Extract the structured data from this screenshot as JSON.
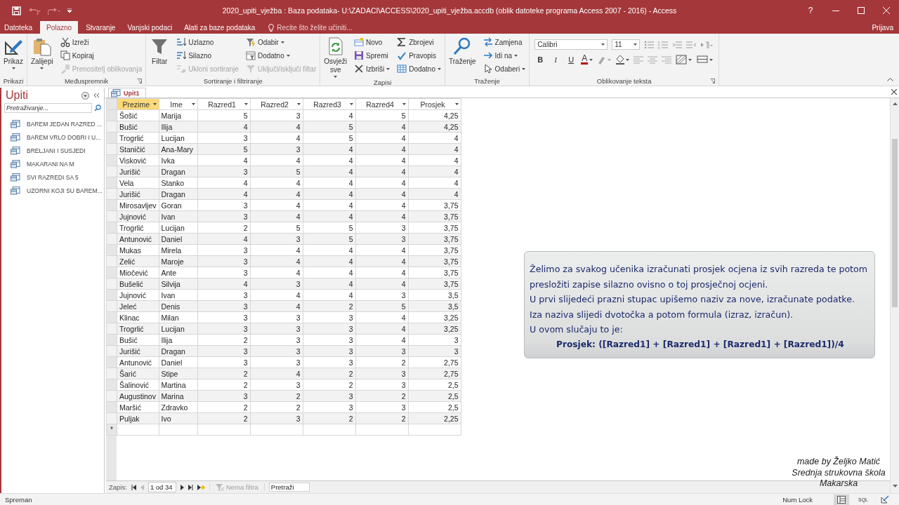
{
  "window": {
    "title": "2020_upiti_vježba : Baza podataka- U:\\ZADACI\\ACCESS\\2020_upiti_vježba.accdb (oblik datoteke programa Access 2007 - 2016) - Access",
    "help": "?"
  },
  "ribbon_tabs": [
    {
      "label": "Datoteka",
      "selected": false
    },
    {
      "label": "Polazno",
      "selected": true
    },
    {
      "label": "Stvaranje",
      "selected": false
    },
    {
      "label": "Vanjski podaci",
      "selected": false
    },
    {
      "label": "Alati za baze podataka",
      "selected": false
    }
  ],
  "tell_me": {
    "placeholder": "Recite što želite učiniti..."
  },
  "account": "Prijava",
  "ribbon": {
    "groups": [
      {
        "label": "Prikazi",
        "kind": "buttons",
        "launcher": false,
        "columns": [
          [
            {
              "label": "Prikaz",
              "kind": "large",
              "dropdown": true,
              "disabled": false
            }
          ]
        ]
      },
      {
        "label": "Međuspremnik",
        "kind": "buttons",
        "launcher": true,
        "columns": [
          [
            {
              "label": "Zalijepi",
              "kind": "large",
              "dropdown": true,
              "disabled": false
            }
          ],
          [
            {
              "label": "Izreži",
              "kind": "small",
              "dropdown": false,
              "disabled": false
            },
            {
              "label": "Kopiraj",
              "kind": "small",
              "dropdown": false,
              "disabled": false
            },
            {
              "label": "Prenositelj oblikovanja",
              "kind": "small",
              "dropdown": false,
              "disabled": true
            }
          ]
        ]
      },
      {
        "label": "Sortiranje i filtriranje",
        "kind": "buttons",
        "launcher": false,
        "columns": [
          [
            {
              "label": "Filtar",
              "kind": "large",
              "dropdown": false,
              "disabled": false
            }
          ],
          [
            {
              "label": "Uzlazno",
              "kind": "small",
              "dropdown": false,
              "disabled": false
            },
            {
              "label": "Silazno",
              "kind": "small",
              "dropdown": false,
              "disabled": false
            },
            {
              "label": "Ukloni sortiranje",
              "kind": "small",
              "dropdown": false,
              "disabled": true
            }
          ],
          [
            {
              "label": "Odabir",
              "kind": "small",
              "dropdown": true,
              "disabled": false
            },
            {
              "label": "Dodatno",
              "kind": "small",
              "dropdown": true,
              "disabled": false
            },
            {
              "label": "Uključi/isključi filtar",
              "kind": "small",
              "dropdown": false,
              "disabled": true
            }
          ]
        ]
      },
      {
        "label": "Zapisi",
        "kind": "buttons",
        "launcher": false,
        "columns": [
          [
            {
              "label": "Osvježi sve",
              "kind": "large",
              "dropdown": true,
              "disabled": false
            }
          ],
          [
            {
              "label": "Novo",
              "kind": "small",
              "dropdown": false,
              "disabled": false
            },
            {
              "label": "Spremi",
              "kind": "small",
              "dropdown": false,
              "disabled": false
            },
            {
              "label": "Izbriši",
              "kind": "small",
              "dropdown": true,
              "disabled": false
            }
          ],
          [
            {
              "label": "Zbrojevi",
              "kind": "small",
              "dropdown": false,
              "disabled": false
            },
            {
              "label": "Pravopis",
              "kind": "small",
              "dropdown": false,
              "disabled": false
            },
            {
              "label": "Dodatno",
              "kind": "small",
              "dropdown": true,
              "disabled": false
            }
          ]
        ]
      },
      {
        "label": "Traženje",
        "kind": "buttons",
        "launcher": false,
        "columns": [
          [
            {
              "label": "Traženje",
              "kind": "large",
              "dropdown": false,
              "disabled": false
            }
          ],
          [
            {
              "label": "Zamjena",
              "kind": "small",
              "dropdown": false,
              "disabled": false
            },
            {
              "label": "Idi na",
              "kind": "small",
              "dropdown": true,
              "disabled": false
            },
            {
              "label": "Odaberi",
              "kind": "small",
              "dropdown": true,
              "disabled": false
            }
          ]
        ]
      },
      {
        "label": "Oblikovanje teksta",
        "kind": "font",
        "launcher": true,
        "font": "Calibri",
        "size": "11",
        "styles": [
          "B",
          "I",
          "U"
        ],
        "font_color": "A"
      }
    ]
  },
  "navigation_pane": {
    "title": "Upiti",
    "search": {
      "placeholder": "Pretraživanje..."
    },
    "items": [
      {
        "label": "BAREM JEDAN RAZRED ..."
      },
      {
        "label": "BAREM VRLO DOBRI I U..."
      },
      {
        "label": "BRELJANI I SUSJEDI"
      },
      {
        "label": "MAKARANI NA M"
      },
      {
        "label": "SVI RAZREDI SA 5"
      },
      {
        "label": "UZORNI KOJI SU BAREM..."
      }
    ]
  },
  "document_tabs": [
    {
      "label": "Upit1",
      "selected": true
    }
  ],
  "datasheet": {
    "columns": [
      {
        "label": "Prezime",
        "kind": "text",
        "selected": true
      },
      {
        "label": "Ime",
        "kind": "text",
        "selected": false
      },
      {
        "label": "Razred1",
        "kind": "number",
        "selected": false
      },
      {
        "label": "Razred2",
        "kind": "number",
        "selected": false
      },
      {
        "label": "Razred3",
        "kind": "number",
        "selected": false
      },
      {
        "label": "Razred4",
        "kind": "number",
        "selected": false
      },
      {
        "label": "Prosjek",
        "kind": "number",
        "selected": false
      }
    ],
    "rows": [
      [
        "Šošić",
        "Marija",
        "5",
        "3",
        "4",
        "5",
        "4,25"
      ],
      [
        "Bušić",
        "Ilija",
        "4",
        "4",
        "5",
        "4",
        "4,25"
      ],
      [
        "Trogrlić",
        "Lucijan",
        "3",
        "4",
        "5",
        "4",
        "4"
      ],
      [
        "Staničić",
        "Ana-Mary",
        "5",
        "3",
        "4",
        "4",
        "4"
      ],
      [
        "Visković",
        "Ivka",
        "4",
        "4",
        "4",
        "4",
        "4"
      ],
      [
        "Jurišić",
        "Dragan",
        "3",
        "5",
        "4",
        "4",
        "4"
      ],
      [
        "Vela",
        "Stanko",
        "4",
        "4",
        "4",
        "4",
        "4"
      ],
      [
        "Jurišić",
        "Dragan",
        "4",
        "4",
        "4",
        "4",
        "4"
      ],
      [
        "Mirosavljev",
        "Goran",
        "3",
        "4",
        "4",
        "4",
        "3,75"
      ],
      [
        "Jujnović",
        "Ivan",
        "3",
        "4",
        "4",
        "4",
        "3,75"
      ],
      [
        "Trogrlić",
        "Lucijan",
        "2",
        "5",
        "5",
        "3",
        "3,75"
      ],
      [
        "Antunović",
        "Daniel",
        "4",
        "3",
        "5",
        "3",
        "3,75"
      ],
      [
        "Mukas",
        "Mirela",
        "3",
        "4",
        "4",
        "4",
        "3,75"
      ],
      [
        "Zelić",
        "Maroje",
        "3",
        "4",
        "4",
        "4",
        "3,75"
      ],
      [
        "Miočević",
        "Ante",
        "3",
        "4",
        "4",
        "4",
        "3,75"
      ],
      [
        "Bušelić",
        "Silvija",
        "4",
        "3",
        "4",
        "4",
        "3,75"
      ],
      [
        "Jujnović",
        "Ivan",
        "3",
        "4",
        "4",
        "3",
        "3,5"
      ],
      [
        "Jeleć",
        "Denis",
        "3",
        "4",
        "2",
        "5",
        "3,5"
      ],
      [
        "Klinac",
        "Milan",
        "3",
        "3",
        "3",
        "4",
        "3,25"
      ],
      [
        "Trogrlić",
        "Lucijan",
        "3",
        "3",
        "3",
        "4",
        "3,25"
      ],
      [
        "Bušić",
        "Ilija",
        "2",
        "3",
        "3",
        "4",
        "3"
      ],
      [
        "Jurišić",
        "Dragan",
        "3",
        "3",
        "3",
        "3",
        "3"
      ],
      [
        "Antunović",
        "Daniel",
        "3",
        "3",
        "3",
        "2",
        "2,75"
      ],
      [
        "Šarić",
        "Stipe",
        "2",
        "4",
        "2",
        "3",
        "2,75"
      ],
      [
        "Šalinović",
        "Martina",
        "2",
        "3",
        "2",
        "3",
        "2,5"
      ],
      [
        "Augustinov",
        "Marina",
        "3",
        "2",
        "3",
        "2",
        "2,5"
      ],
      [
        "Maršić",
        "Zdravko",
        "2",
        "2",
        "3",
        "3",
        "2,5"
      ],
      [
        "Puljak",
        "Ivo",
        "2",
        "3",
        "2",
        "2",
        "2,25"
      ]
    ],
    "new_row_marker": "*"
  },
  "record_navigator": {
    "label": "Zapis:",
    "position": "1 od 34",
    "filter": "Nema filtra",
    "search": {
      "placeholder": "Pretraži"
    }
  },
  "note": {
    "paragraphs": [
      "Želimo za svakog učenika izračunati prosjek ocjena iz svih razreda te potom presložiti zapise silazno ovisno o toj prosječnoj ocjeni.",
      "U prvi slijedeći prazni stupac upišemo naziv za nove, izračunate podatke.",
      "Iza naziva slijedi dvotočka a potom formula (izraz, izračun).",
      "U ovom slučaju to je:"
    ],
    "formula": "Prosjek: ([Razred1] + [Razred1] + [Razred1] + [Razred1])/4"
  },
  "credit": {
    "lines": [
      "made by Željko Matić",
      "Srednja strukovna škola",
      "Makarska"
    ]
  },
  "status_bar": {
    "text": "Spreman",
    "indicators": [
      "Num Lock"
    ],
    "views": [
      {
        "kind": "datasheet",
        "selected": true
      },
      {
        "kind": "sql",
        "label": "SQL",
        "selected": false
      },
      {
        "kind": "design",
        "selected": false
      }
    ]
  }
}
